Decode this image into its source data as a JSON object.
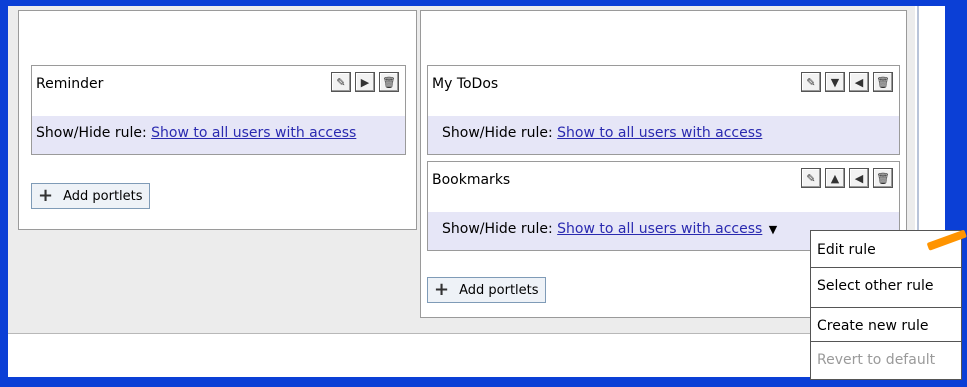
{
  "left_column": {
    "portlet": {
      "title": "Reminder",
      "rule_label": "Show/Hide rule:",
      "rule_link": "Show to all users with access"
    },
    "add_portlets_label": "Add portlets"
  },
  "right_column": {
    "portlets": [
      {
        "title": "My ToDos",
        "rule_label": "Show/Hide rule:",
        "rule_link": "Show to all users with access"
      },
      {
        "title": "Bookmarks",
        "rule_label": "Show/Hide rule:",
        "rule_link": "Show to all users with access"
      }
    ],
    "add_portlets_label": "Add portlets"
  },
  "rule_menu": {
    "items": [
      "Edit rule",
      "Select other rule",
      "Create new rule",
      "Revert to default"
    ],
    "disabled_item": "Revert to default"
  },
  "icons": {
    "edit": "pencil-icon",
    "move_right": "arrow-right-icon",
    "move_down": "arrow-down-icon",
    "move_up": "arrow-up-icon",
    "move_left": "arrow-left-icon",
    "delete": "trash-icon",
    "add": "plus-icon",
    "dropdown": "caret-down-icon"
  },
  "colors": {
    "background": "#0b3fd6",
    "portlet_body": "#e6e6f7",
    "link": "#2a2ab0",
    "pointer": "#ff9400"
  }
}
